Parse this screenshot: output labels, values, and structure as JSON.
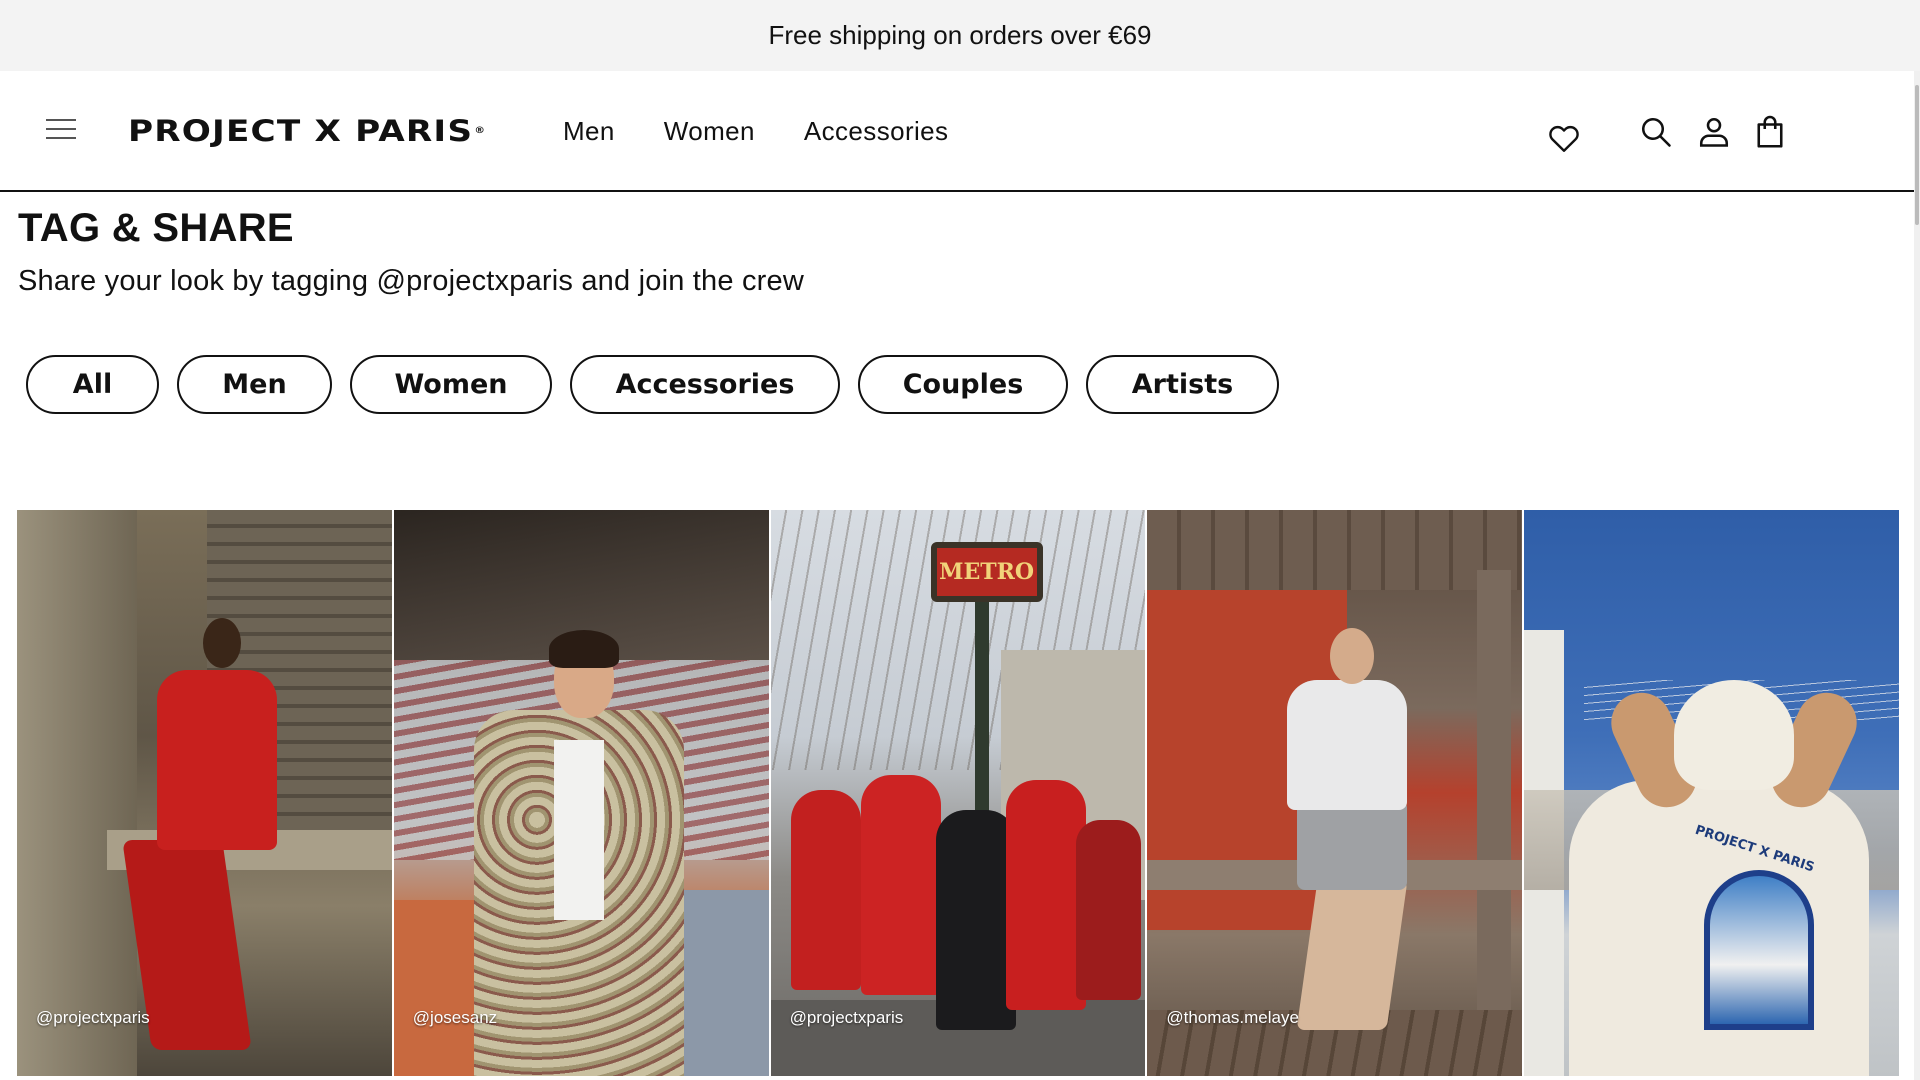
{
  "announcement": {
    "text": "Free shipping on orders over €69"
  },
  "header": {
    "logo_text": "PROJECT X PARIS",
    "logo_mark": "®",
    "nav": [
      {
        "label": "Men"
      },
      {
        "label": "Women"
      },
      {
        "label": "Accessories"
      }
    ],
    "icons": {
      "menu": "hamburger-icon",
      "wishlist": "heart-icon",
      "search": "search-icon",
      "account": "user-icon",
      "cart": "shopping-bag-icon"
    }
  },
  "page": {
    "title": "TAG & SHARE",
    "subtitle": "Share your look by tagging @projectxparis and join the crew"
  },
  "filters": [
    {
      "label": "All"
    },
    {
      "label": "Men"
    },
    {
      "label": "Women"
    },
    {
      "label": "Accessories"
    },
    {
      "label": "Couples"
    },
    {
      "label": "Artists"
    }
  ],
  "gallery": [
    {
      "handle": "@projectxparis"
    },
    {
      "handle": "@josesanz"
    },
    {
      "handle": "@projectxparis"
    },
    {
      "handle": "@thomas.melaye"
    },
    {
      "handle": ""
    }
  ],
  "photo_text": {
    "metro_sign": "METRO",
    "shirt_print": "PROJECT X PARIS"
  },
  "colors": {
    "text": "#111111",
    "announcement_bg": "#f3f3f3",
    "background": "#ffffff"
  }
}
